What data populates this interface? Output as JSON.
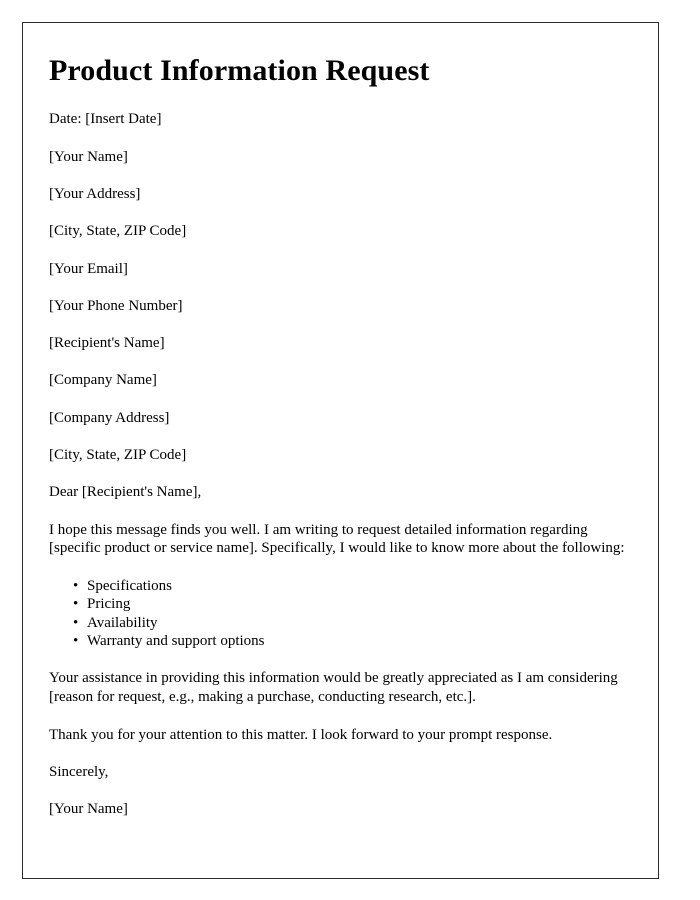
{
  "document": {
    "title": "Product Information Request",
    "date_line": "Date: [Insert Date]",
    "sender_block": [
      "[Your Name]",
      "[Your Address]",
      "[City, State, ZIP Code]",
      "[Your Email]",
      "[Your Phone Number]"
    ],
    "recipient_block": [
      "[Recipient's Name]",
      "[Company Name]",
      "[Company Address]",
      "[City, State, ZIP Code]"
    ],
    "salutation": "Dear [Recipient's Name],",
    "intro_paragraph": "I hope this message finds you well. I am writing to request detailed information regarding [specific product or service name]. Specifically, I would like to know more about the following:",
    "request_items": [
      "Specifications",
      "Pricing",
      "Availability",
      "Warranty and support options"
    ],
    "assistance_paragraph": "Your assistance in providing this information would be greatly appreciated as I am considering [reason for request, e.g., making a purchase, conducting research, etc.].",
    "thanks_paragraph": "Thank you for your attention to this matter. I look forward to your prompt response.",
    "closing": "Sincerely,",
    "signature_name": "[Your Name]"
  },
  "style": {
    "page_background": "#ffffff",
    "border_color": "#2b2b2b",
    "text_color": "#000000"
  }
}
